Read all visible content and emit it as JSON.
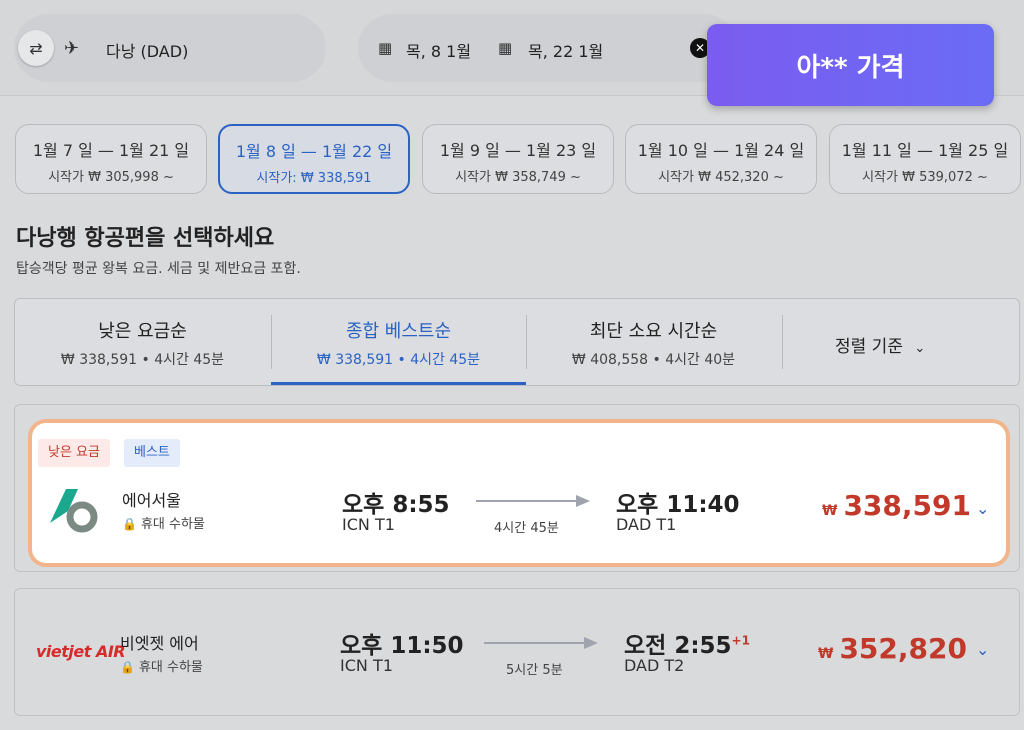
{
  "search": {
    "destination": "다낭 (DAD)",
    "depart_date": "목, 8 1월",
    "return_date": "목, 22 1월",
    "price_alert_label": "아** 가격"
  },
  "date_chips": [
    {
      "range": "1월 7 일 — 1월 21 일",
      "from": "시작가 ₩ 305,998 ~"
    },
    {
      "range": "1월 8 일 — 1월 22 일",
      "from": "시작가: ₩ 338,591"
    },
    {
      "range": "1월 9 일 — 1월 23 일",
      "from": "시작가 ₩ 358,749 ~"
    },
    {
      "range": "1월 10 일 — 1월 24 일",
      "from": "시작가 ₩ 452,320 ~"
    },
    {
      "range": "1월 11 일 — 1월 25 일",
      "from": "시작가 ₩ 539,072 ~"
    }
  ],
  "heading": {
    "title": "다낭행 항공편을 선택하세요",
    "subtitle": "탑승객당 평균 왕복 요금. 세금 및 제반요금 포함."
  },
  "sort": {
    "tabs": [
      {
        "label": "낮은 요금순",
        "meta": "₩ 338,591 • 4시간 45분"
      },
      {
        "label": "종합 베스트순",
        "meta": "₩ 338,591 • 4시간 45분"
      },
      {
        "label": "최단 소요 시간순",
        "meta": "₩ 408,558 • 4시간 40분"
      }
    ],
    "dropdown_label": "정렬 기준"
  },
  "flights": [
    {
      "badges": [
        "낮은 요금",
        "베스트"
      ],
      "airline": "에어서울",
      "baggage": "휴대 수하물",
      "depart_time": "오후 8:55",
      "depart_airport": "ICN T1",
      "duration": "4시간 45분",
      "arrive_time": "오후 11:40",
      "arrive_airport": "DAD T1",
      "day_offset": "",
      "currency": "₩",
      "price": "338,591"
    },
    {
      "badges": [],
      "airline": "비엣젯 에어",
      "logo_text": "vietjet AIR",
      "baggage": "휴대 수하물",
      "depart_time": "오후 11:50",
      "depart_airport": "ICN T1",
      "duration": "5시간 5분",
      "arrive_time": "오전 2:55",
      "arrive_airport": "DAD T2",
      "day_offset": "+1",
      "currency": "₩",
      "price": "352,820"
    }
  ],
  "colors": {
    "accent": "#2a63c4",
    "price": "#c0392b",
    "highlight_border": "#f2b48a",
    "alert_button": "#7b5cf0"
  }
}
